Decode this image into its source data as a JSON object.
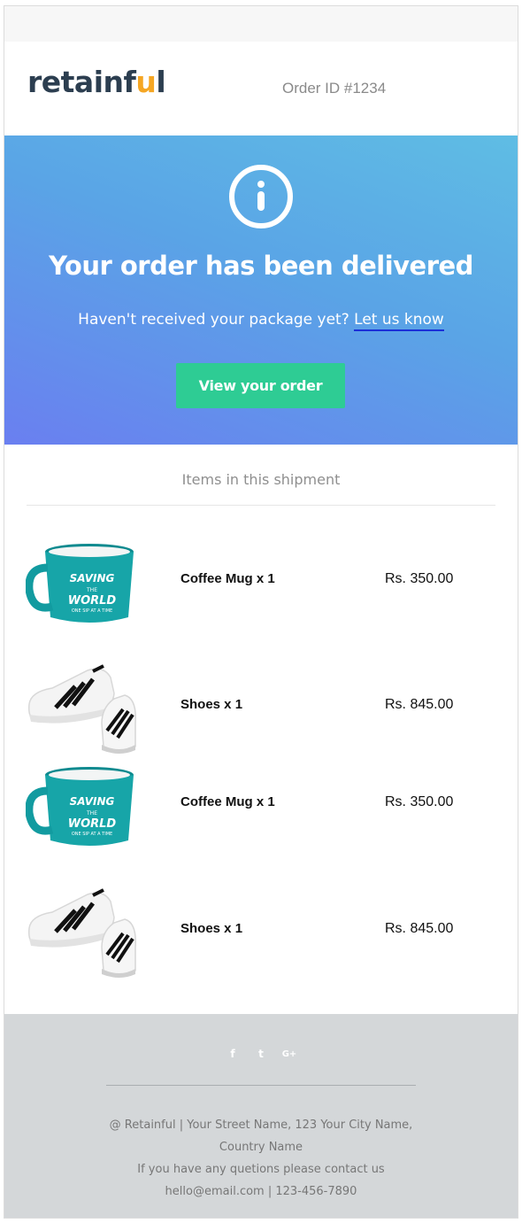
{
  "header": {
    "logo_text_a": "retainf",
    "logo_text_u": "u",
    "logo_text_b": "l",
    "order_id": "Order ID #1234"
  },
  "hero": {
    "title": "Your order has been delivered",
    "subtitle": "Haven't received your package yet?",
    "link_label": "Let us know",
    "button_label": "View your order"
  },
  "shipment": {
    "title": "Items in this shipment",
    "items": [
      {
        "name": "Coffee Mug x 1",
        "price": "Rs. 350.00",
        "icon": "coffee-mug-image"
      },
      {
        "name": "Shoes x 1",
        "price": "Rs. 845.00",
        "icon": "shoes-image"
      },
      {
        "name": "Coffee Mug x 1",
        "price": "Rs. 350.00",
        "icon": "coffee-mug-image"
      },
      {
        "name": "Shoes x 1",
        "price": "Rs. 845.00",
        "icon": "shoes-image"
      }
    ]
  },
  "footer": {
    "socials": [
      {
        "icon": "facebook-icon",
        "glyph": "f"
      },
      {
        "icon": "twitter-icon",
        "glyph": "t"
      },
      {
        "icon": "google-plus-icon",
        "glyph": "G+"
      }
    ],
    "address_line_1": "@ Retainful | Your Street Name, 123 Your City Name,",
    "address_line_2": "Country Name",
    "contact_line_1": "If you have any quetions please contact us",
    "contact_line_2": "hello@email.com | 123-456-7890"
  },
  "colors": {
    "brand_dark": "#2c3e50",
    "brand_accent": "#f5a623",
    "button_green": "#2ecc94",
    "footer_bg": "#d4d7d9"
  }
}
